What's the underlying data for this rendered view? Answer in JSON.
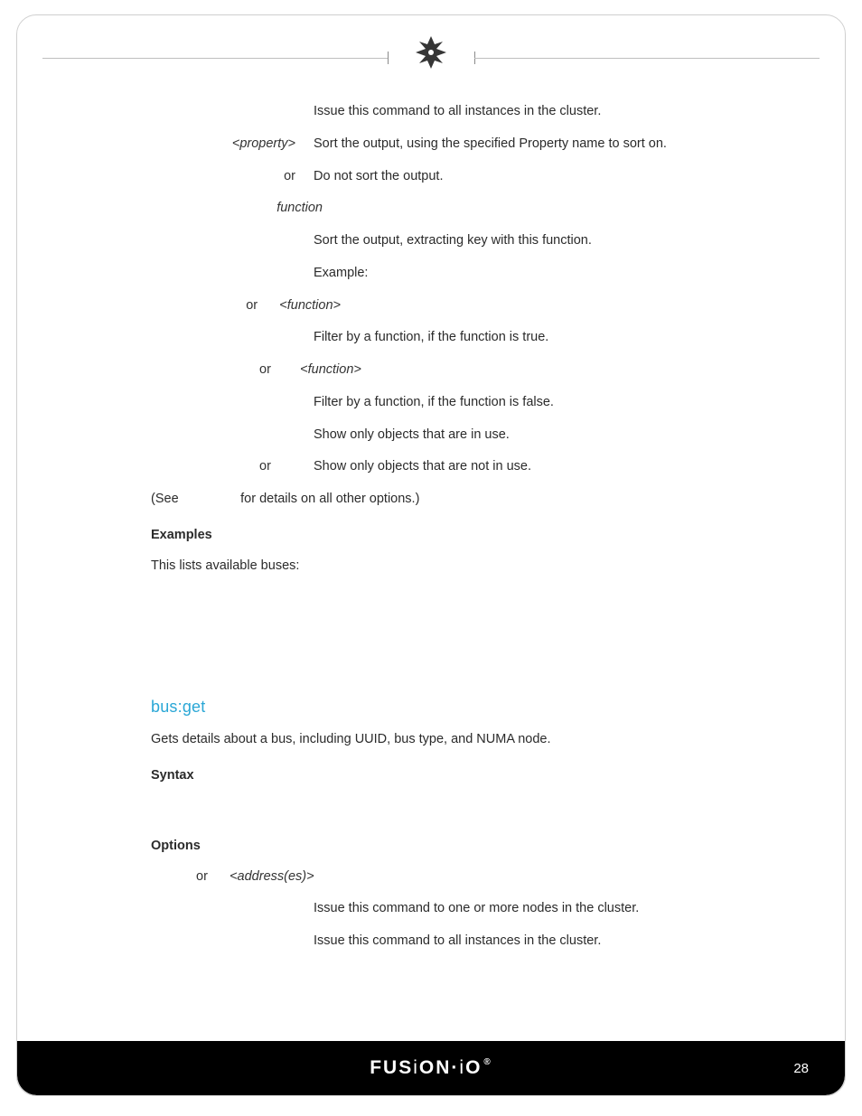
{
  "options_top": [
    {
      "label": "",
      "desc": "Issue this command to all instances in the cluster."
    },
    {
      "label": "<property>",
      "desc": "Sort the output, using the specified Property name to sort on."
    },
    {
      "label": "or",
      "desc": "Do not sort the output."
    }
  ],
  "function_label": "function",
  "function_lines": [
    "Sort the output, extracting key with this function.",
    "Example:"
  ],
  "filter_true": {
    "label_or": "or",
    "label_arg": "<function>",
    "desc": "Filter by a function, if the function is true."
  },
  "filter_false": {
    "label_or": "or",
    "label_arg": "<function>",
    "desc": "Filter by a function, if the function is false."
  },
  "inuse_true": {
    "desc": "Show only objects that are in use."
  },
  "inuse_false": {
    "label_or": "or",
    "desc": "Show only objects that are not in use."
  },
  "see_line_prefix": "(See",
  "see_line_suffix": "for details on all other options.)",
  "examples_heading": "Examples",
  "examples_text": "This lists available buses:",
  "busget": {
    "title": "bus:get",
    "intro": "Gets details about a bus, including UUID, bus type, and NUMA node.",
    "syntax_heading": "Syntax",
    "options_heading": "Options",
    "opt_addr_or": "or",
    "opt_addr_arg": "<address(es)>",
    "opt_addr_desc": "Issue this command to one or more nodes in the cluster.",
    "opt_all_desc": "Issue this command to all instances in the cluster."
  },
  "footer": {
    "brand_a": "FUS",
    "brand_i": "i",
    "brand_b": "ON·",
    "brand_i2": "i",
    "brand_c": "O",
    "reg": "®",
    "page": "28"
  }
}
